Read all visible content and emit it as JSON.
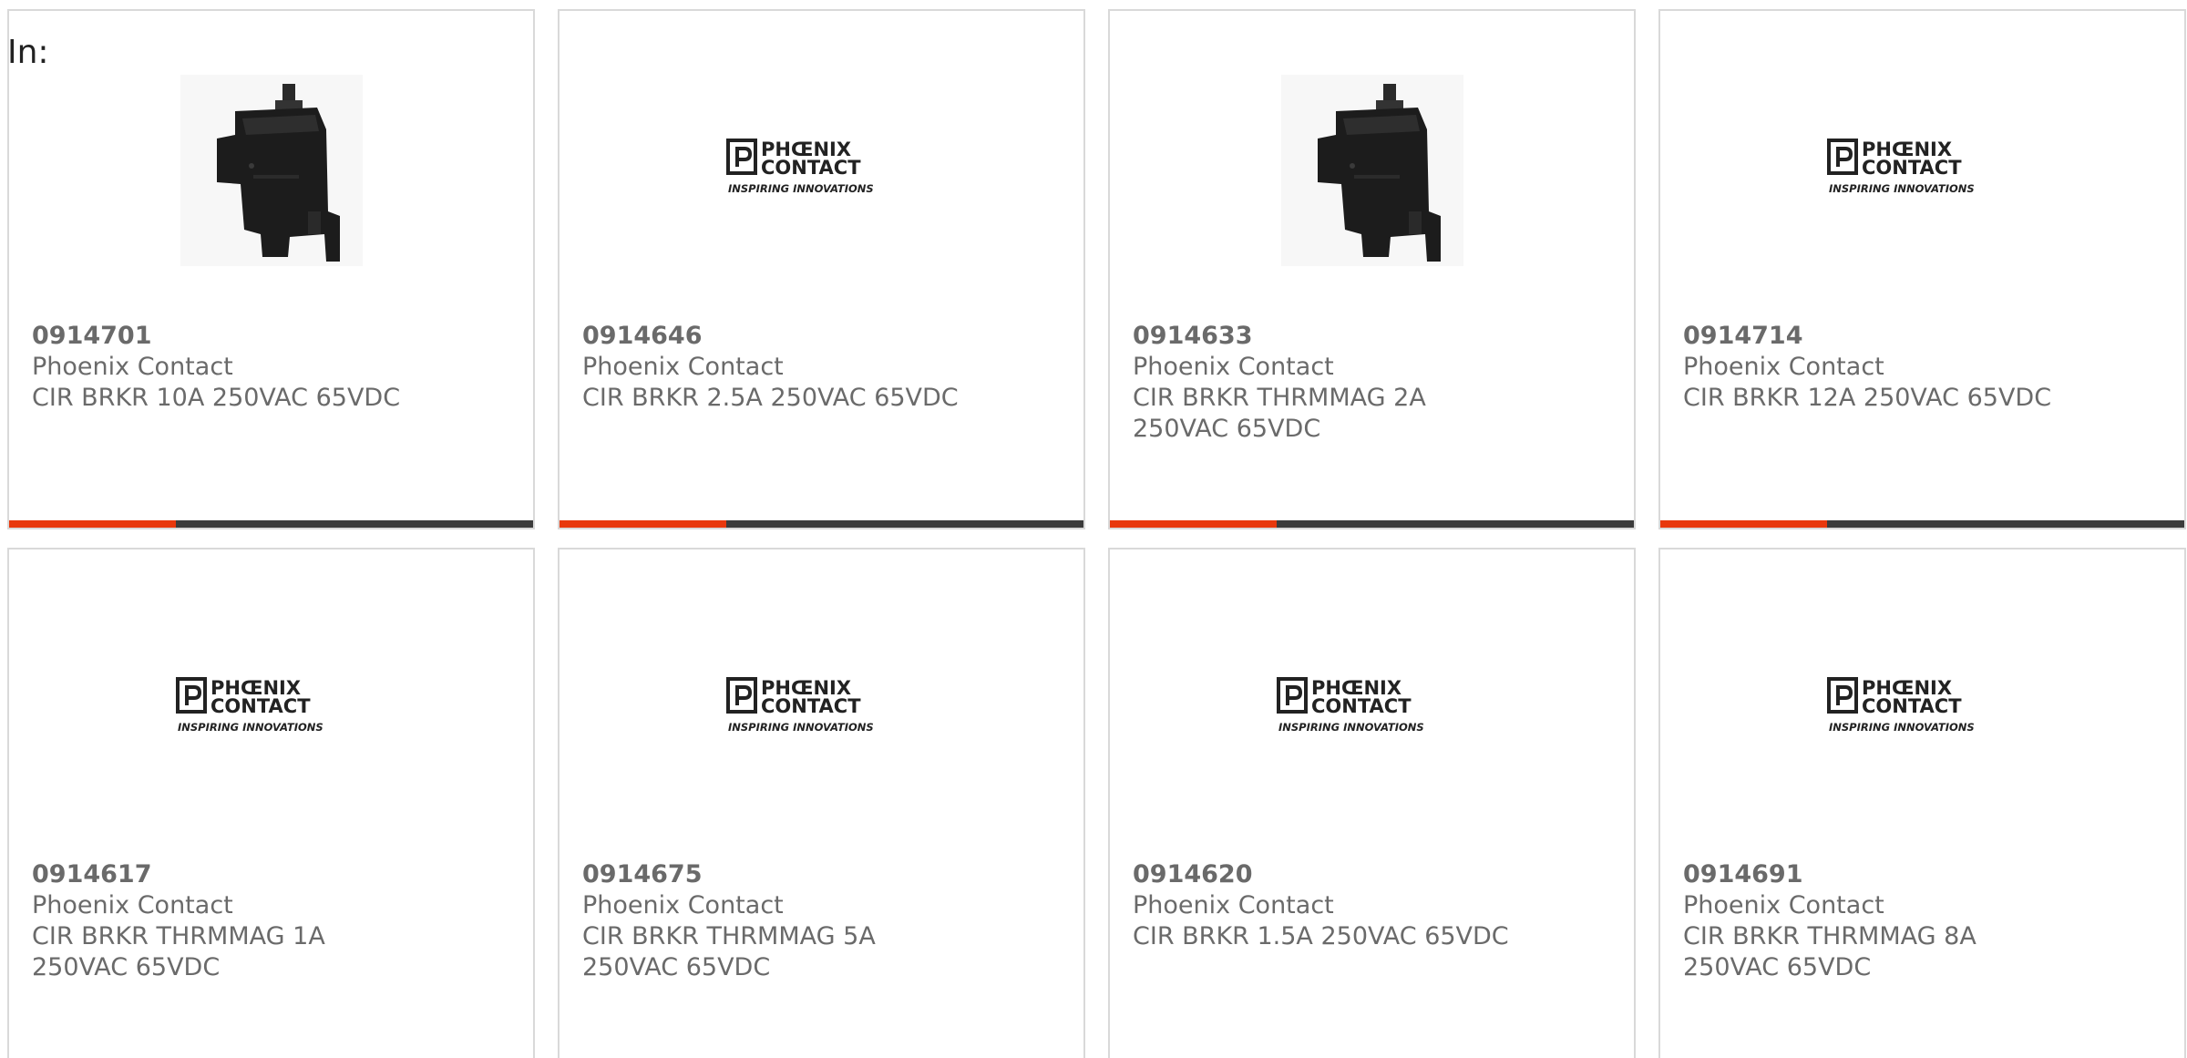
{
  "filter": {
    "label": "In:"
  },
  "colors": {
    "accent": "#e8380d",
    "bar": "#3c3c3c",
    "text": "#6a6a6a",
    "border": "#d9d9d9"
  },
  "logo": {
    "line1": "PHŒNIX",
    "line2": "CONTACT",
    "tagline": "INSPIRING INNOVATIONS"
  },
  "products": [
    {
      "part_number": "0914701",
      "manufacturer": "Phoenix Contact",
      "description": "CIR BRKR 10A 250VAC 65VDC",
      "image": "circuit-breaker-photo"
    },
    {
      "part_number": "0914646",
      "manufacturer": "Phoenix Contact",
      "description": "CIR BRKR 2.5A 250VAC 65VDC",
      "image": "phoenix-contact-logo"
    },
    {
      "part_number": "0914633",
      "manufacturer": "Phoenix Contact",
      "description": "CIR BRKR THRMMAG 2A 250VAC 65VDC",
      "image": "circuit-breaker-photo"
    },
    {
      "part_number": "0914714",
      "manufacturer": "Phoenix Contact",
      "description": "CIR BRKR 12A 250VAC 65VDC",
      "image": "phoenix-contact-logo"
    },
    {
      "part_number": "0914617",
      "manufacturer": "Phoenix Contact",
      "description": "CIR BRKR THRMMAG 1A 250VAC 65VDC",
      "image": "phoenix-contact-logo"
    },
    {
      "part_number": "0914675",
      "manufacturer": "Phoenix Contact",
      "description": "CIR BRKR THRMMAG 5A 250VAC 65VDC",
      "image": "phoenix-contact-logo"
    },
    {
      "part_number": "0914620",
      "manufacturer": "Phoenix Contact",
      "description": "CIR BRKR 1.5A 250VAC 65VDC",
      "image": "phoenix-contact-logo"
    },
    {
      "part_number": "0914691",
      "manufacturer": "Phoenix Contact",
      "description": "CIR BRKR THRMMAG 8A 250VAC 65VDC",
      "image": "phoenix-contact-logo"
    }
  ]
}
